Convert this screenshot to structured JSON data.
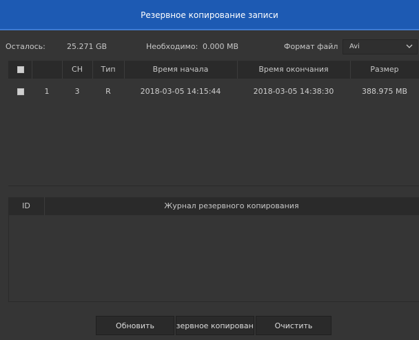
{
  "window": {
    "title": "Резервное копирование записи"
  },
  "info": {
    "remaining_label": "Осталось:",
    "remaining_value": "25.271 GB",
    "required_label": "Необходимо:",
    "required_value": "0.000 MB",
    "format_label": "Формат файл",
    "format_value": "Avi"
  },
  "table": {
    "columns": [
      "CH",
      "Тип",
      "Время начала",
      "Время окончания",
      "Размер"
    ],
    "rows": [
      {
        "checked": false,
        "no": "1",
        "ch": "3",
        "type": "R",
        "start": "2018-03-05 14:15:44",
        "end": "2018-03-05 14:38:30",
        "size": "388.975 MB"
      }
    ]
  },
  "log": {
    "id_header": "ID",
    "title": "Журнал резервного копирования"
  },
  "buttons": {
    "refresh": "Обновить",
    "backup": "Резервное копирование",
    "clear": "Очистить"
  },
  "colors": {
    "title_bg": "#1d5ab3",
    "panel_bg": "#353535",
    "header_bg": "#2a2a2a"
  }
}
